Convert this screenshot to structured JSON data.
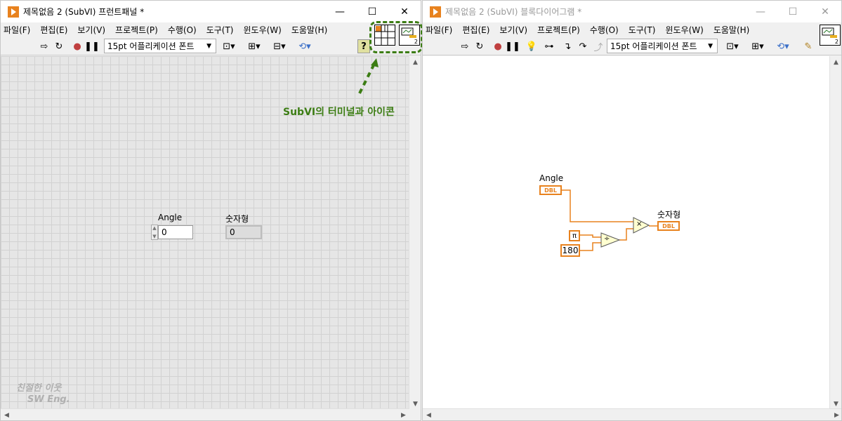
{
  "front_panel": {
    "title": "제목없음 2 (SubVI) 프런트패널 *",
    "menu": [
      "파일(F)",
      "편집(E)",
      "보기(V)",
      "프로젝트(P)",
      "수행(O)",
      "도구(T)",
      "윈도우(W)",
      "도움말(H)"
    ],
    "font_select": "15pt 어플리케이션 폰트",
    "control": {
      "label": "Angle",
      "value": "0"
    },
    "indicator": {
      "label": "숫자형",
      "value": "0"
    },
    "annotation": "SubVI의 터미널과 아이콘",
    "watermark_line1": "친절한 이웃",
    "watermark_line2": "SW Eng."
  },
  "block_diagram": {
    "title": "제목없음 2 (SubVI) 블록다이어그램 *",
    "menu": [
      "파일(F)",
      "편집(E)",
      "보기(V)",
      "프로젝트(P)",
      "수행(O)",
      "도구(T)",
      "윈도우(W)",
      "도움말(H)"
    ],
    "font_select": "15pt 어플리케이션 폰트",
    "input_label": "Angle",
    "input_type": "DBL",
    "output_label": "숫자형",
    "output_type": "DBL",
    "pi_const": "π",
    "const_180": "180",
    "multiply": "×",
    "divide": "÷"
  },
  "window_controls": {
    "minimize": "—",
    "maximize": "☐",
    "close": "✕"
  },
  "icon_number": "2",
  "colors": {
    "accent": "#e8821e",
    "annotation": "#3c7d14",
    "wire": "#e8821e"
  }
}
